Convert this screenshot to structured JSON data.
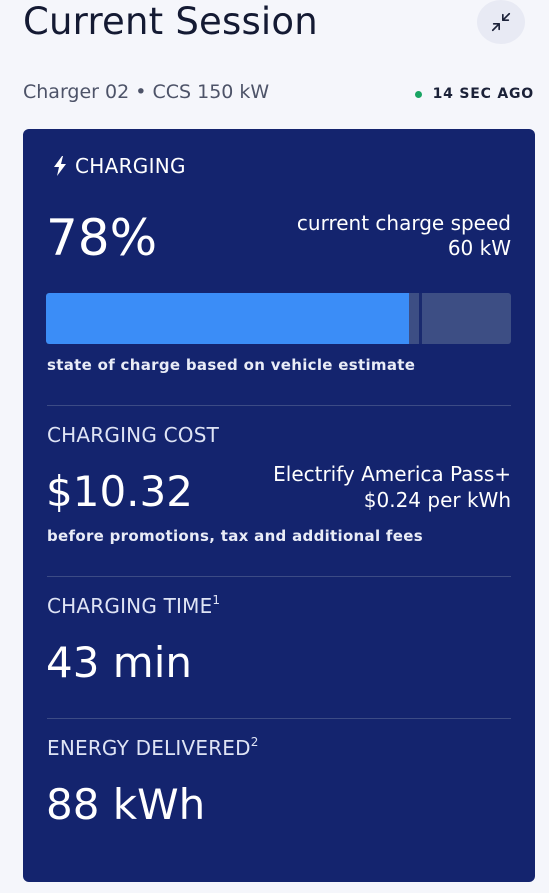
{
  "header": {
    "title": "Current Session",
    "collapse_icon": "collapse-arrows-icon",
    "charger_info": "Charger 02 • CCS 150 kW",
    "last_updated": "14 SEC AGO",
    "status_dot_color": "#19a463"
  },
  "card": {
    "background_color": "#14246e",
    "status": {
      "icon": "lightning-icon",
      "label": "CHARGING"
    },
    "state_of_charge": {
      "value": "78%",
      "fill_fraction": 0.78,
      "target_fraction": 0.805,
      "speed_label": "current charge speed",
      "speed_value": "60 kW",
      "note": "state of charge based on vehicle estimate",
      "bar_color": "#3b8df7"
    },
    "cost": {
      "label": "CHARGING COST",
      "value": "$10.32",
      "plan_name": "Electrify America Pass+",
      "plan_rate": "$0.24 per kWh",
      "note": "before promotions, tax and additional fees"
    },
    "time": {
      "label": "CHARGING TIME",
      "footnote": "1",
      "value": "43 min"
    },
    "energy": {
      "label": "ENERGY DELIVERED",
      "footnote": "2",
      "value": "88 kWh"
    }
  }
}
